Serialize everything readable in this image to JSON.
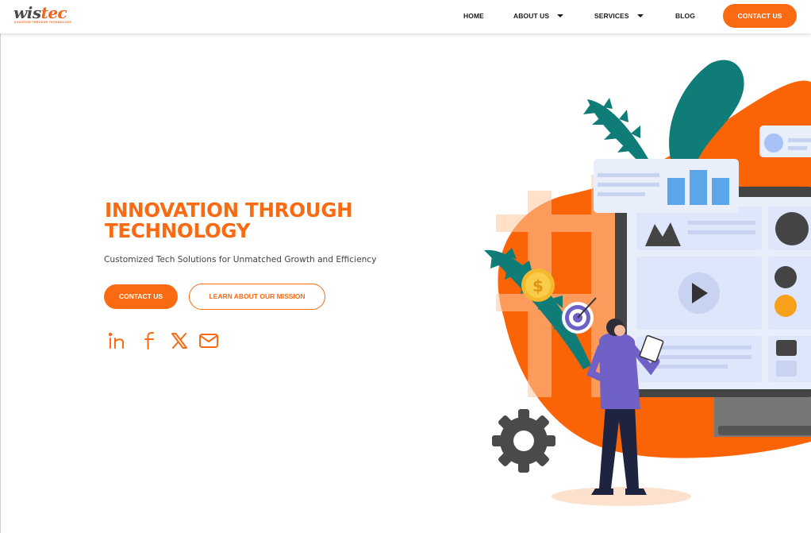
{
  "brand": {
    "logo_part1": "wis",
    "logo_part2": "tec",
    "tagline": "SOLUTION THROUGH TECHNOLOGY"
  },
  "nav": {
    "home": "HOME",
    "about": "ABOUT US",
    "services": "SERVICES",
    "blog": "BLOG",
    "contact": "CONTACT US"
  },
  "hero": {
    "title_line1": "INNOVATION THROUGH",
    "title_line2": "TECHNOLOGY",
    "subtitle": "Customized Tech Solutions for Unmatched Growth and Efficiency",
    "primary_button": "CONTACT US",
    "secondary_button": "LEARN ABOUT OUR MISSION"
  },
  "social": [
    "linkedin-icon",
    "facebook-icon",
    "x-icon",
    "mail-icon"
  ],
  "colors": {
    "accent": "#f96a13",
    "logo_gray": "#4a4a4a",
    "teal": "#0f7c78",
    "text": "#1a1a1a"
  }
}
